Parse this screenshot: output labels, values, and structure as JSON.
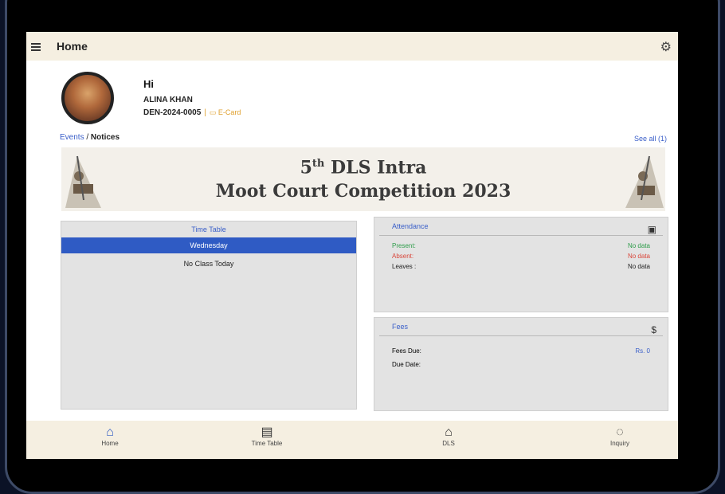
{
  "app": {
    "title": "Home"
  },
  "profile": {
    "greeting": "Hi",
    "name": "ALINA KHAN",
    "reg_no": "DEN-2024-0005",
    "card_label": "E-Card"
  },
  "events": {
    "label_a": "Events",
    "label_b": "Notices",
    "see_all": "See all (1)"
  },
  "banner": {
    "line1_a": "5",
    "line1_sup": "th",
    "line1_b": " DLS Intra",
    "line2": "Moot Court Competition 2023"
  },
  "timetable": {
    "title": "Time Table",
    "day": "Wednesday",
    "empty": "No Class Today"
  },
  "attendance": {
    "title": "Attendance",
    "rows": [
      {
        "label": "Present:",
        "value": "No data"
      },
      {
        "label": "Absent:",
        "value": "No data"
      },
      {
        "label": "Leaves :",
        "value": "No data"
      }
    ]
  },
  "fees": {
    "title": "Fees",
    "due_label": "Fees Due:",
    "due_value": "Rs. 0",
    "date_label": "Due Date:"
  },
  "nav": [
    {
      "label": "Home"
    },
    {
      "label": "Time Table"
    },
    {
      "label": "DLS"
    },
    {
      "label": "Inquiry"
    }
  ],
  "colors": {
    "accent": "#2f5bc4",
    "present": "#2e9c4a",
    "absent": "#d9473b",
    "bars": "#f5efe1"
  }
}
